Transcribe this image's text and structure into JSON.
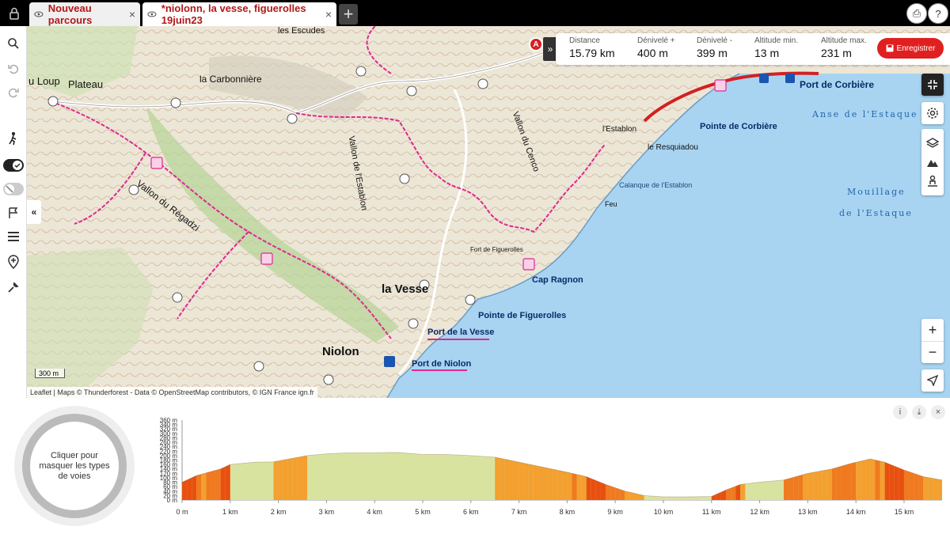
{
  "tabs": [
    {
      "label": "Nouveau parcours",
      "close": "×"
    },
    {
      "label": "*niolonn, la vesse, figuerolles 19juin23",
      "close": "×"
    }
  ],
  "new_tab": "+",
  "top_buttons": {
    "print": "⎙",
    "help": "?"
  },
  "map": {
    "marker_A": "A",
    "collapse_label": "«",
    "expand_label": "»",
    "stats": [
      {
        "label": "Distance",
        "value": "15.79 km"
      },
      {
        "label": "Dénivelé +",
        "value": "400 m"
      },
      {
        "label": "Dénivelé -",
        "value": "399 m"
      },
      {
        "label": "Altitude min.",
        "value": "13 m"
      },
      {
        "label": "Altitude max.",
        "value": "231 m"
      }
    ],
    "save_label": "Enregistrer",
    "zoom_in": "+",
    "zoom_out": "−",
    "scale_label": "300 m",
    "attribution": "Leaflet | Maps © Thunderforest - Data © OpenStreetMap contributors, © IGN France ign.fr",
    "labels": {
      "port_corbiere": "Port de Corbière",
      "pointe_corbiere": "Pointe de Corbière",
      "anse_estaque": "Anse de l'Estaque",
      "mouillage": "Mouillage",
      "de_lestaque": "de l'Estaque",
      "resquiadou": "le Resquiadou",
      "establon": "l'Establon",
      "calanque": "Calanque de l'Establon",
      "cap_ragnon": "Cap Ragnon",
      "la_vesse": "la Vesse",
      "pointe_figuerolles": "Pointe de Figuerolles",
      "port_vesse": "Port de la Vesse",
      "port_niolon": "Port de Niolon",
      "niolon": "Niolon",
      "carbonniere": "la Carbonnière",
      "plateau": "Plateau",
      "loup": "u Loup",
      "vallon_regadzi": "Vallon du Régadzi",
      "vallon_establon": "Vallon de l'Establon",
      "vallon_cenco": "Vallon du Cenco",
      "feu": "Feu",
      "fort_figuerolles": "Fort de Figuerolles",
      "les_escudes": "les Escudes"
    }
  },
  "profile": {
    "donut_text": "Cliquer pour masquer les types de voies",
    "controls": {
      "info": "i",
      "download": "⤓",
      "close": "×"
    }
  },
  "chart_data": {
    "type": "area",
    "title": "",
    "xlabel": "",
    "ylabel": "",
    "ylim": [
      0,
      360
    ],
    "xlim": [
      0,
      15.79
    ],
    "y_ticks": [
      "360 m",
      "340 m",
      "320 m",
      "300 m",
      "280 m",
      "260 m",
      "240 m",
      "220 m",
      "200 m",
      "180 m",
      "160 m",
      "140 m",
      "120 m",
      "100 m",
      "80 m",
      "60 m",
      "40 m",
      "20 m",
      "0 m"
    ],
    "x_ticks": [
      "0 m",
      "1 km",
      "2 km",
      "3 km",
      "4 km",
      "5 km",
      "6 km",
      "7 km",
      "8 km",
      "9 km",
      "10 km",
      "11 km",
      "12 km",
      "13 km",
      "14 km",
      "15 km"
    ],
    "series": [
      {
        "x": [
          0,
          0.3,
          0.8,
          1.0,
          1.5,
          1.9,
          2.3,
          2.6,
          3.0,
          3.4,
          4.0,
          4.5,
          5.0,
          5.5,
          6.0,
          6.5,
          7.0,
          7.5,
          8.0,
          8.4,
          8.8,
          9.2,
          9.6,
          10.0,
          10.5,
          11.0,
          11.3,
          11.6,
          12.0,
          12.5,
          13.0,
          13.5,
          13.9,
          14.3,
          14.6,
          15.0,
          15.4,
          15.79
        ],
        "y": [
          80,
          110,
          140,
          160,
          170,
          172,
          188,
          200,
          208,
          212,
          213,
          214,
          205,
          205,
          200,
          193,
          170,
          148,
          125,
          105,
          70,
          40,
          20,
          14,
          14,
          16,
          45,
          70,
          80,
          90,
          120,
          140,
          165,
          185,
          170,
          135,
          105,
          90
        ]
      }
    ],
    "segment_colors": [
      "#e85010",
      "#f07a20",
      "#f4a030",
      "#d9e3a0",
      "#b05020"
    ]
  }
}
